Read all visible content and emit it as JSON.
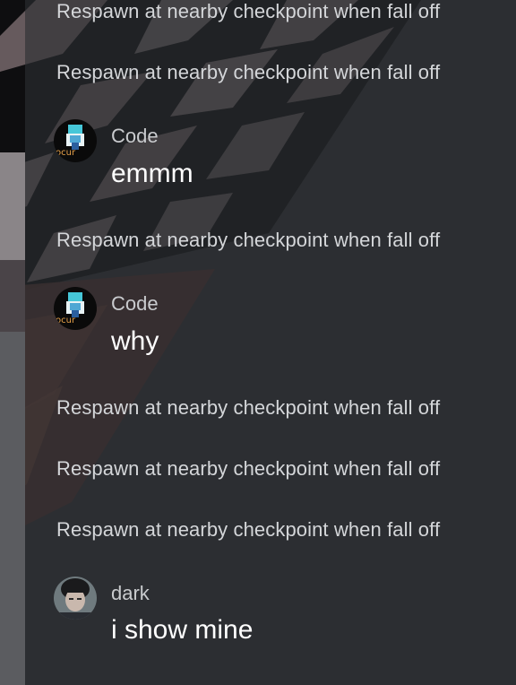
{
  "chat": {
    "system_messages": [
      "Respawn at nearby checkpoint when fall off",
      "Respawn at nearby checkpoint when fall off",
      "Respawn at nearby checkpoint when fall off",
      "Respawn at nearby checkpoint when fall off",
      "Respawn at nearby checkpoint when fall off",
      "Respawn at nearby checkpoint when fall off"
    ],
    "user_messages": [
      {
        "username": "Code",
        "text": "emmm",
        "avatar": "pixel-avatar-icon"
      },
      {
        "username": "Code",
        "text": "why",
        "avatar": "pixel-avatar-icon"
      },
      {
        "username": "dark",
        "text": "i show mine",
        "avatar": "profile-photo-avatar"
      }
    ]
  }
}
